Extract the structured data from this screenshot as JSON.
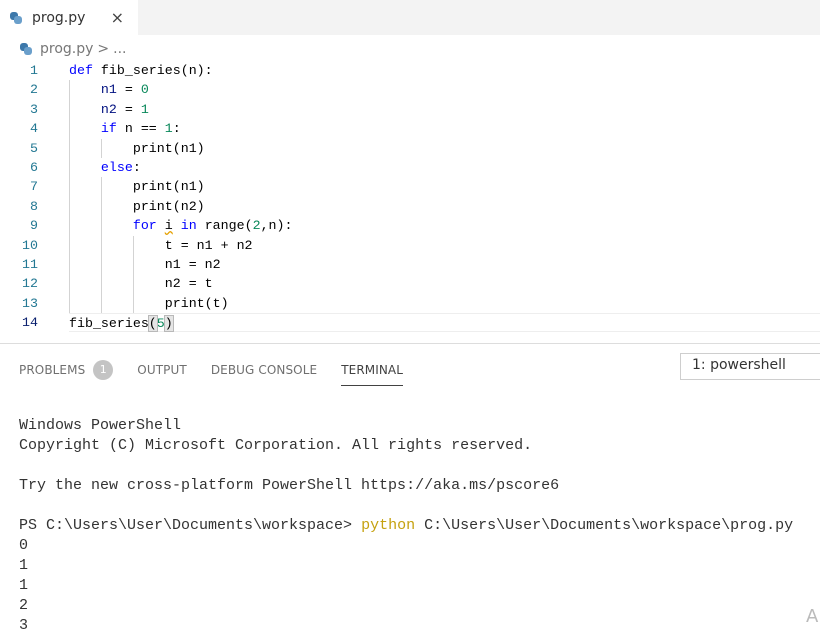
{
  "tab": {
    "filename": "prog.py",
    "close_icon": "×"
  },
  "breadcrumb": {
    "file": "prog.py",
    "separator": ">",
    "more": "..."
  },
  "editor": {
    "current_line": 14,
    "lines": [
      {
        "n": "1",
        "indent": 0,
        "tokens": [
          [
            "def",
            "kw"
          ],
          [
            " fib_series(n):",
            ""
          ]
        ]
      },
      {
        "n": "2",
        "indent": 1,
        "tokens": [
          [
            "n1",
            "id"
          ],
          [
            " = ",
            ""
          ],
          [
            "0",
            "num"
          ]
        ]
      },
      {
        "n": "3",
        "indent": 1,
        "tokens": [
          [
            "n2",
            "id"
          ],
          [
            " = ",
            ""
          ],
          [
            "1",
            "num"
          ]
        ]
      },
      {
        "n": "4",
        "indent": 1,
        "tokens": [
          [
            "if",
            "kw"
          ],
          [
            " n == ",
            ""
          ],
          [
            "1",
            "num"
          ],
          [
            ":",
            ""
          ]
        ]
      },
      {
        "n": "5",
        "indent": 2,
        "tokens": [
          [
            "print(n1)",
            ""
          ]
        ]
      },
      {
        "n": "6",
        "indent": 1,
        "tokens": [
          [
            "else",
            "kw"
          ],
          [
            ":",
            ""
          ]
        ]
      },
      {
        "n": "7",
        "indent": 2,
        "tokens": [
          [
            "print(n1)",
            ""
          ]
        ]
      },
      {
        "n": "8",
        "indent": 2,
        "tokens": [
          [
            "print(n2)",
            ""
          ]
        ]
      },
      {
        "n": "9",
        "indent": 2,
        "tokens": [
          [
            "for",
            "kw"
          ],
          [
            " ",
            ""
          ],
          [
            "i",
            "squig"
          ],
          [
            " ",
            ""
          ],
          [
            "in",
            "kw"
          ],
          [
            " range(",
            ""
          ],
          [
            "2",
            "num"
          ],
          [
            ",n):",
            ""
          ]
        ]
      },
      {
        "n": "10",
        "indent": 3,
        "tokens": [
          [
            "t = n1 + n2",
            ""
          ]
        ]
      },
      {
        "n": "11",
        "indent": 3,
        "tokens": [
          [
            "n1 = n2",
            ""
          ]
        ]
      },
      {
        "n": "12",
        "indent": 3,
        "tokens": [
          [
            "n2 = t",
            ""
          ]
        ]
      },
      {
        "n": "13",
        "indent": 3,
        "tokens": [
          [
            "print(t)",
            ""
          ]
        ]
      },
      {
        "n": "14",
        "indent": 0,
        "tokens": [
          [
            "fib_series",
            ""
          ],
          [
            "(",
            "br"
          ],
          [
            "5",
            "num"
          ],
          [
            ")",
            "br"
          ]
        ]
      }
    ]
  },
  "panel": {
    "tabs": {
      "problems": "PROBLEMS",
      "problems_count": "1",
      "output": "OUTPUT",
      "debug": "DEBUG CONSOLE",
      "terminal": "TERMINAL"
    },
    "terminal_select": "1: powershell",
    "terminal": {
      "l1": "Windows PowerShell",
      "l2": "Copyright (C) Microsoft Corporation. All rights reserved.",
      "l3": "Try the new cross-platform PowerShell https://aka.ms/pscore6",
      "prompt": "PS C:\\Users\\User\\Documents\\workspace> ",
      "cmd": "python",
      "arg": " C:\\Users\\User\\Documents\\workspace\\prog.py",
      "out": [
        "0",
        "1",
        "1",
        "2",
        "3"
      ]
    },
    "corner_hint": "A"
  }
}
